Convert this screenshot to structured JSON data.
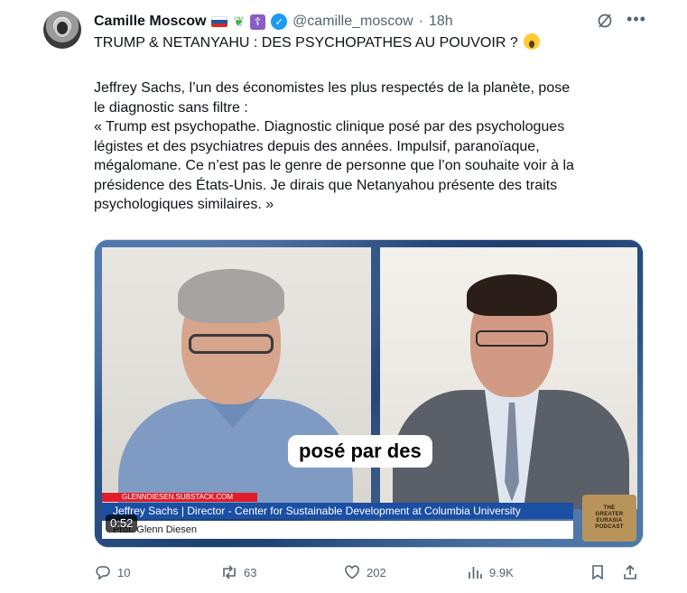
{
  "author": {
    "name": "Camille Moscow",
    "handle": "@camille_moscow",
    "separator": "·",
    "time": "18h",
    "flag_colors": [
      "#ffffff",
      "#1c57a5",
      "#d52b1e"
    ],
    "verified_color": "#1d9bf0"
  },
  "tweet": {
    "headline": "TRUMP & NETANYAHU : DES PSYCHOPATHES AU POUVOIR ?",
    "lines": [
      "Jeffrey Sachs, l’un des économistes les plus respectés de la planète, pose",
      "le diagnostic sans filtre :",
      "« Trump est psychopathe. Diagnostic clinique posé par des psychologues",
      "légistes et des psychiatres depuis des années. Impulsif, paranoïaque,",
      "mégalomane. Ce n’est pas le genre de personne que l’on souhaite voir à la",
      "présidence des États-Unis. Je dirais que Netanyahou présente des traits",
      "psychologiques similaires. »"
    ]
  },
  "video": {
    "caption": "posé par des",
    "site_tag": "GLENNDIESEN.SUBSTACK.COM",
    "lower_third": "Jeffrey Sachs | Director - Center for Sustainable Development at Columbia University",
    "host_label": "Prof. Glenn Diesen",
    "duration": "0:52",
    "podcast_logo": [
      "THE",
      "GREATER",
      "EURASIA",
      "PODCAST"
    ]
  },
  "actions": {
    "replies": "10",
    "reposts": "63",
    "likes": "202",
    "views": "9.9K"
  },
  "icons": {
    "grok": "grok-icon",
    "more": "more-icon",
    "reply": "reply-icon",
    "repost": "repost-icon",
    "like": "heart-icon",
    "views": "views-icon",
    "bookmark": "bookmark-icon",
    "share": "share-icon"
  }
}
